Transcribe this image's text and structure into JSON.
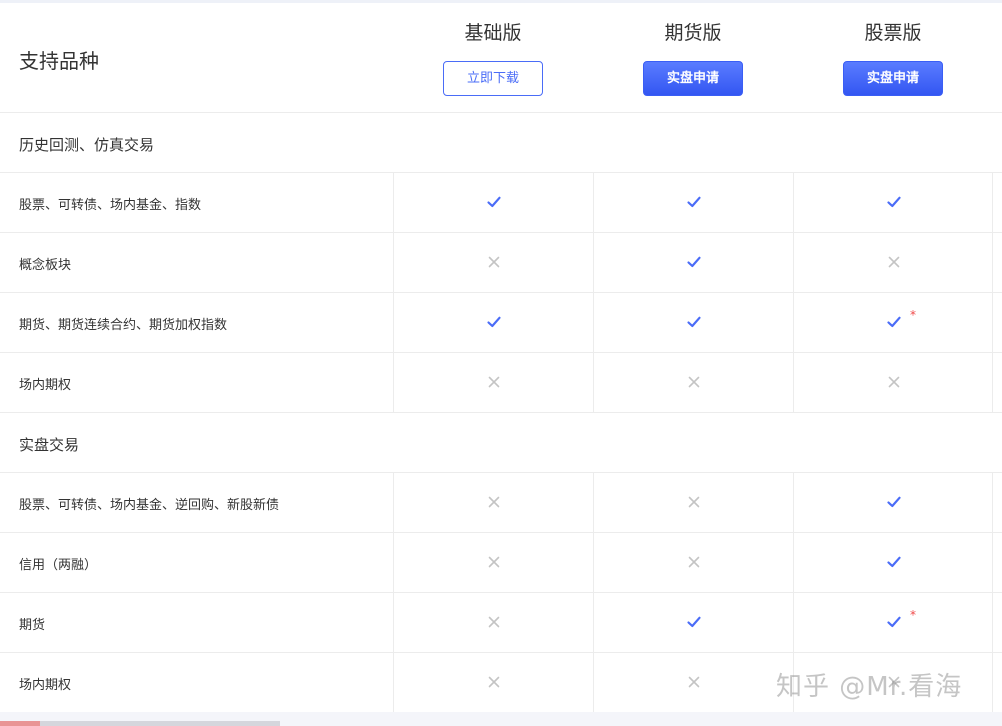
{
  "header": {
    "title": "支持品种",
    "plans": [
      {
        "name": "基础版",
        "button": "立即下载"
      },
      {
        "name": "期货版",
        "button": "实盘申请"
      },
      {
        "name": "股票版",
        "button": "实盘申请"
      }
    ]
  },
  "sections": [
    {
      "title": "历史回测、仿真交易",
      "rows": [
        {
          "label": "股票、可转债、场内基金、指数",
          "support": [
            "check",
            "check",
            "check"
          ],
          "star": [
            false,
            false,
            false
          ]
        },
        {
          "label": "概念板块",
          "support": [
            "cross",
            "check",
            "cross"
          ],
          "star": [
            false,
            false,
            false
          ]
        },
        {
          "label": "期货、期货连续合约、期货加权指数",
          "support": [
            "check",
            "check",
            "check"
          ],
          "star": [
            false,
            false,
            true
          ]
        },
        {
          "label": "场内期权",
          "support": [
            "cross",
            "cross",
            "cross"
          ],
          "star": [
            false,
            false,
            false
          ]
        }
      ]
    },
    {
      "title": "实盘交易",
      "rows": [
        {
          "label": "股票、可转债、场内基金、逆回购、新股新债",
          "support": [
            "cross",
            "cross",
            "check"
          ],
          "star": [
            false,
            false,
            false
          ]
        },
        {
          "label": "信用（两融）",
          "support": [
            "cross",
            "cross",
            "check"
          ],
          "star": [
            false,
            false,
            false
          ]
        },
        {
          "label": "期货",
          "support": [
            "cross",
            "check",
            "check"
          ],
          "star": [
            false,
            false,
            true
          ]
        },
        {
          "label": "场内期权",
          "support": [
            "cross",
            "cross",
            "cross"
          ],
          "star": [
            false,
            false,
            false
          ]
        }
      ]
    }
  ],
  "star_symbol": "*",
  "watermark": "知乎 @Mr.看海",
  "colors": {
    "check": "#4a6cf7",
    "cross": "#c4c4c4",
    "star": "#f04a4a",
    "accent": "#3a5ef5"
  }
}
